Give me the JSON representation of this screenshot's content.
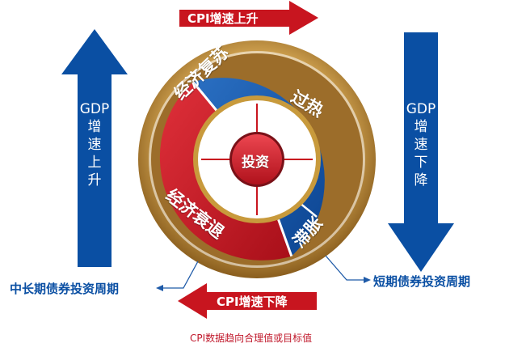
{
  "top_arrow": {
    "text": "CPI增速上升",
    "color": "#c8151f"
  },
  "bottom_arrow": {
    "text": "CPI增速下降",
    "color": "#c8151f"
  },
  "left_arrow": {
    "lines": [
      "GDP",
      "增",
      "速",
      "上",
      "升"
    ],
    "color": "#0a4fa3"
  },
  "right_arrow": {
    "lines": [
      "GDP",
      "增",
      "速",
      "下",
      "降"
    ],
    "color": "#0a4fa3"
  },
  "wheel": {
    "center": "投资",
    "segments": {
      "recovery": "经济复苏",
      "overheat": "过热",
      "stagflation": "滞胀",
      "recession": "经济衰退"
    },
    "colors": {
      "red": "#c8151f",
      "blue": "#1256a8",
      "gold": "#c89a3c"
    }
  },
  "cycles": {
    "long": "中长期债券投资周期",
    "short": "短期债券投资周期"
  },
  "footnote": "CPI数据趋向合理值或目标值"
}
